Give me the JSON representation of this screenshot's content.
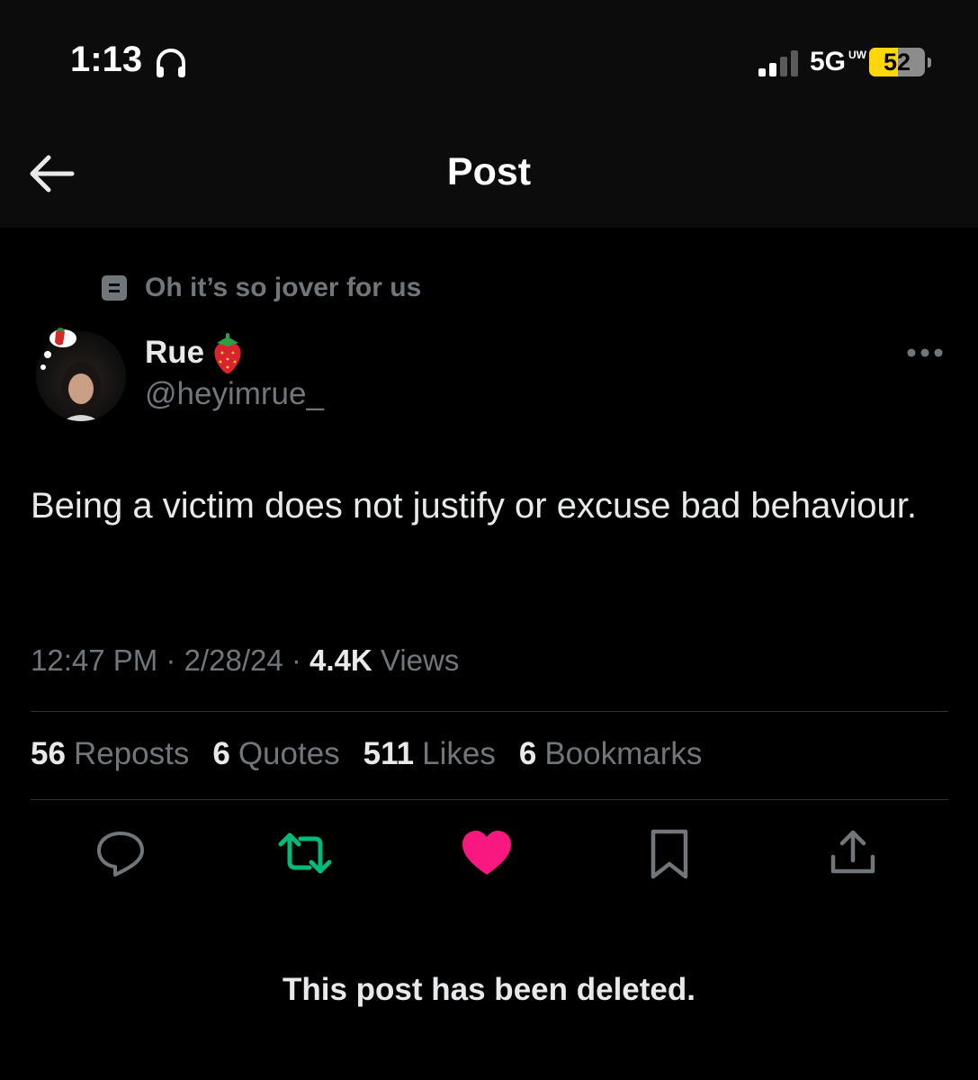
{
  "status_bar": {
    "time": "1:13",
    "network": "5G",
    "network_sub": "UW",
    "battery": "52",
    "battery_level_percent": 52,
    "battery_color": "#ffd60a"
  },
  "header": {
    "title": "Post"
  },
  "post": {
    "context_label": "Oh it’s so jover for us",
    "author_name": "Rue",
    "author_handle": "@heyimrue_",
    "text": "Being a victim does not justify or excuse bad behaviour.",
    "time": "12:47 PM",
    "date": "2/28/24",
    "views_count": "4.4K",
    "views_label": "Views",
    "stats": [
      {
        "count": "56",
        "label": "Reposts"
      },
      {
        "count": "6",
        "label": "Quotes"
      },
      {
        "count": "511",
        "label": "Likes"
      },
      {
        "count": "6",
        "label": "Bookmarks"
      }
    ],
    "deleted_notice": "This post has been deleted."
  },
  "colors": {
    "repost_active": "#00ba7c",
    "like_active": "#f91880",
    "muted": "#71767b"
  }
}
